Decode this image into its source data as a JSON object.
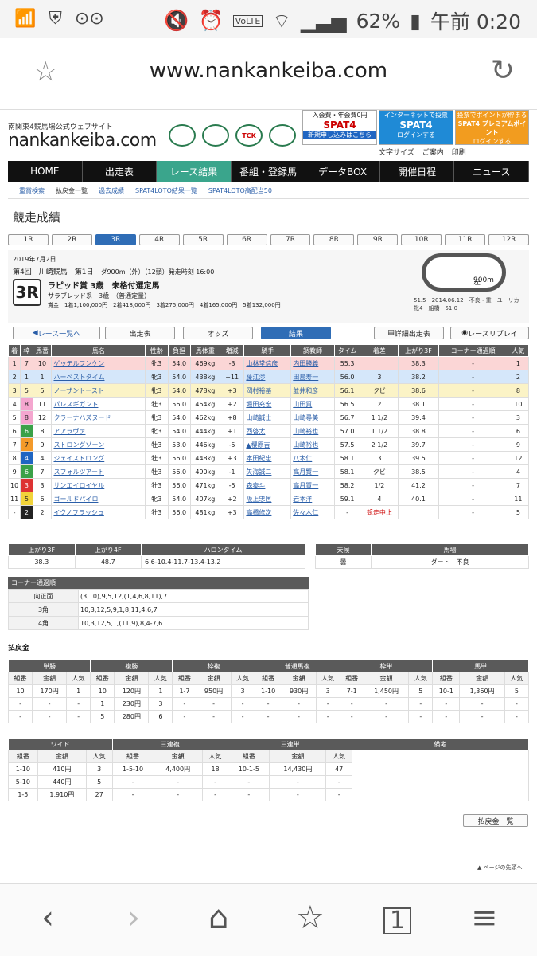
{
  "status_bar": {
    "battery": "62%",
    "time": "午前 0:20",
    "volte": "VoLTE",
    "on1": "ON",
    "on2": "ON"
  },
  "browser": {
    "url": "www.nankankeiba.com"
  },
  "site": {
    "subtitle": "南関東4競馬場公式ウェブサイト",
    "logo": "nankankeiba.com",
    "spat_banners": [
      {
        "top": "入会費・年会費0円",
        "main": "SPAT4",
        "bottom": "新規申し込みはこちら"
      },
      {
        "top": "インターネットで投票",
        "main": "SPAT4",
        "bottom": "ログインする"
      },
      {
        "top": "投票でポイントが貯まる",
        "main": "SPAT4 プレミアムポイント",
        "bottom": "ログインする"
      }
    ],
    "utility": [
      "文字サイズ",
      "ご案内",
      "印刷"
    ],
    "logo_badges": [
      "",
      "",
      "TCK",
      ""
    ]
  },
  "nav": {
    "items": [
      "HOME",
      "出走表",
      "レース結果",
      "番組・登録馬",
      "データBOX",
      "開催日程",
      "ニュース"
    ],
    "active": 2
  },
  "subnav": [
    "重賞検索",
    "払戻金一覧",
    "過去成績",
    "SPAT4LOTO結果一覧",
    "SPAT4LOTO高配当50"
  ],
  "page_title": "競走成績",
  "race_tabs": [
    "1R",
    "2R",
    "3R",
    "4R",
    "5R",
    "6R",
    "7R",
    "8R",
    "9R",
    "10R",
    "11R",
    "12R"
  ],
  "race_tab_active": 2,
  "race": {
    "date": "2019年7月2日",
    "meeting": "第4回　川崎競馬　第1日",
    "course_meta": "ダ900m（外）（12頭）発走時刻 16:00",
    "race_no": "3R",
    "name": "ラピッド賞 3歳　未格付選定馬",
    "class": "サラブレッド系　3歳　（普通定量）",
    "prize": "賞金　1着1,100,000円　2着418,000円　3着275,000円　4着165,000円　5着132,000円",
    "track_label": "900m",
    "track_dir": "左",
    "record": "51.5　2014.06.12　不良・重　ユーリカ　牝4　船橋　51.0"
  },
  "buttons": {
    "back": "レース一覧へ",
    "entries": "出走表",
    "odds": "オッズ",
    "result": "結果",
    "detail": "詳細出走表",
    "replay": "レースリプレイ"
  },
  "result_headers": [
    "着",
    "枠",
    "馬番",
    "馬名",
    "性齢",
    "負担",
    "馬体重",
    "増減",
    "騎手",
    "調教師",
    "タイム",
    "着差",
    "上がり3F",
    "コーナー通過順",
    "人気"
  ],
  "results": [
    [
      "1",
      "7",
      "10",
      "ゲッテルフンケン",
      "牝3",
      "54.0",
      "469kg",
      "-3",
      "山林堂信彦",
      "内田勝義",
      "55.3",
      "",
      "38.3",
      "-",
      "1"
    ],
    [
      "2",
      "1",
      "1",
      "ハーベストタイム",
      "牝3",
      "54.0",
      "438kg",
      "+11",
      "藤江渉",
      "田島寿一",
      "56.0",
      "3",
      "38.2",
      "-",
      "2"
    ],
    [
      "3",
      "5",
      "5",
      "ノーザントースト",
      "牝3",
      "54.0",
      "478kg",
      "+3",
      "岡村裕基",
      "並井和彦",
      "56.1",
      "クビ",
      "38.6",
      "-",
      "8"
    ],
    [
      "4",
      "8",
      "11",
      "パレスギガント",
      "牡3",
      "56.0",
      "454kg",
      "+2",
      "堀田充宏",
      "山田質",
      "56.5",
      "2",
      "38.1",
      "-",
      "10"
    ],
    [
      "5",
      "8",
      "12",
      "クラーナハズヌード",
      "牝3",
      "54.0",
      "462kg",
      "+8",
      "山崎誠士",
      "山崎尋美",
      "56.7",
      "1 1/2",
      "39.4",
      "-",
      "3"
    ],
    [
      "6",
      "6",
      "8",
      "アアラヴァ",
      "牝3",
      "54.0",
      "444kg",
      "+1",
      "西啓太",
      "山崎裕也",
      "57.0",
      "1 1/2",
      "38.8",
      "-",
      "6"
    ],
    [
      "7",
      "7",
      "9",
      "ストロングゾーン",
      "牡3",
      "53.0",
      "446kg",
      "-5",
      "▲櫻原吉",
      "山崎裕也",
      "57.5",
      "2 1/2",
      "39.7",
      "-",
      "9"
    ],
    [
      "8",
      "4",
      "4",
      "ジェイストロング",
      "牡3",
      "56.0",
      "448kg",
      "+3",
      "本田紀忠",
      "八木仁",
      "58.1",
      "3",
      "39.5",
      "-",
      "12"
    ],
    [
      "9",
      "6",
      "7",
      "スフォルツアート",
      "牡3",
      "56.0",
      "490kg",
      "-1",
      "矢海誠二",
      "高月賢一",
      "58.1",
      "クビ",
      "38.5",
      "-",
      "4"
    ],
    [
      "10",
      "3",
      "3",
      "サンエイロイヤル",
      "牡3",
      "56.0",
      "471kg",
      "-5",
      "森泰斗",
      "高月賢一",
      "58.2",
      "1/2",
      "41.2",
      "-",
      "7"
    ],
    [
      "11",
      "5",
      "6",
      "ゴールドパイロ",
      "牝3",
      "54.0",
      "407kg",
      "+2",
      "阪上忠匡",
      "岩本洋",
      "59.1",
      "4",
      "40.1",
      "-",
      "11"
    ],
    [
      "-",
      "2",
      "2",
      "イクノフラッシュ",
      "牡3",
      "56.0",
      "481kg",
      "+3",
      "高橋修次",
      "佐々木仁",
      "-",
      "競走中止",
      "",
      "-",
      "5"
    ]
  ],
  "laps": {
    "headers": [
      "上がり3F",
      "上がり4F",
      "ハロンタイム"
    ],
    "values": [
      "38.3",
      "48.7",
      "6.6-10.4-11.7-13.4-13.2"
    ]
  },
  "going": {
    "headers": [
      "天候",
      "馬場"
    ],
    "values": [
      "曇",
      "ダート　不良"
    ]
  },
  "corner": {
    "title": "コーナー通過順",
    "rows": [
      [
        "向正面",
        "(3,10),9,5,12,(1,4,6,8,11),7"
      ],
      [
        "3角",
        "10,3,12,5,9,1,8,11,4,6,7"
      ],
      [
        "4角",
        "10,3,12,5,1,(11,9),8,4-7,6"
      ]
    ]
  },
  "payout_title": "払戻金",
  "pay1": {
    "groups": [
      "単勝",
      "複勝",
      "枠複",
      "普通馬複",
      "枠単",
      "馬単"
    ],
    "sub": [
      "組番",
      "金額",
      "人気"
    ],
    "rows": [
      [
        "10",
        "170円",
        "1",
        "10",
        "120円",
        "1",
        "1-7",
        "950円",
        "3",
        "1-10",
        "930円",
        "3",
        "7-1",
        "1,450円",
        "5",
        "10-1",
        "1,360円",
        "5"
      ],
      [
        "-",
        "-",
        "-",
        "1",
        "230円",
        "3",
        "-",
        "-",
        "-",
        "-",
        "-",
        "-",
        "-",
        "-",
        "-",
        "-",
        "-",
        "-"
      ],
      [
        "-",
        "-",
        "-",
        "5",
        "280円",
        "6",
        "-",
        "-",
        "-",
        "-",
        "-",
        "-",
        "-",
        "-",
        "-",
        "-",
        "-",
        "-"
      ]
    ]
  },
  "pay2": {
    "groups": [
      "ワイド",
      "三連複",
      "三連単",
      "備考"
    ],
    "sub": [
      "組番",
      "金額",
      "人気"
    ],
    "rows": [
      [
        "1-10",
        "410円",
        "3",
        "1-5-10",
        "4,400円",
        "18",
        "10-1-5",
        "14,430円",
        "47"
      ],
      [
        "5-10",
        "440円",
        "5",
        "-",
        "-",
        "-",
        "-",
        "-",
        "-"
      ],
      [
        "1-5",
        "1,910円",
        "27",
        "-",
        "-",
        "-",
        "-",
        "-",
        "-"
      ]
    ]
  },
  "pay_list_button": "払戻金一覧",
  "page_top": "ページの先頭へ",
  "bottom_bar": {
    "tab_count": "1"
  }
}
